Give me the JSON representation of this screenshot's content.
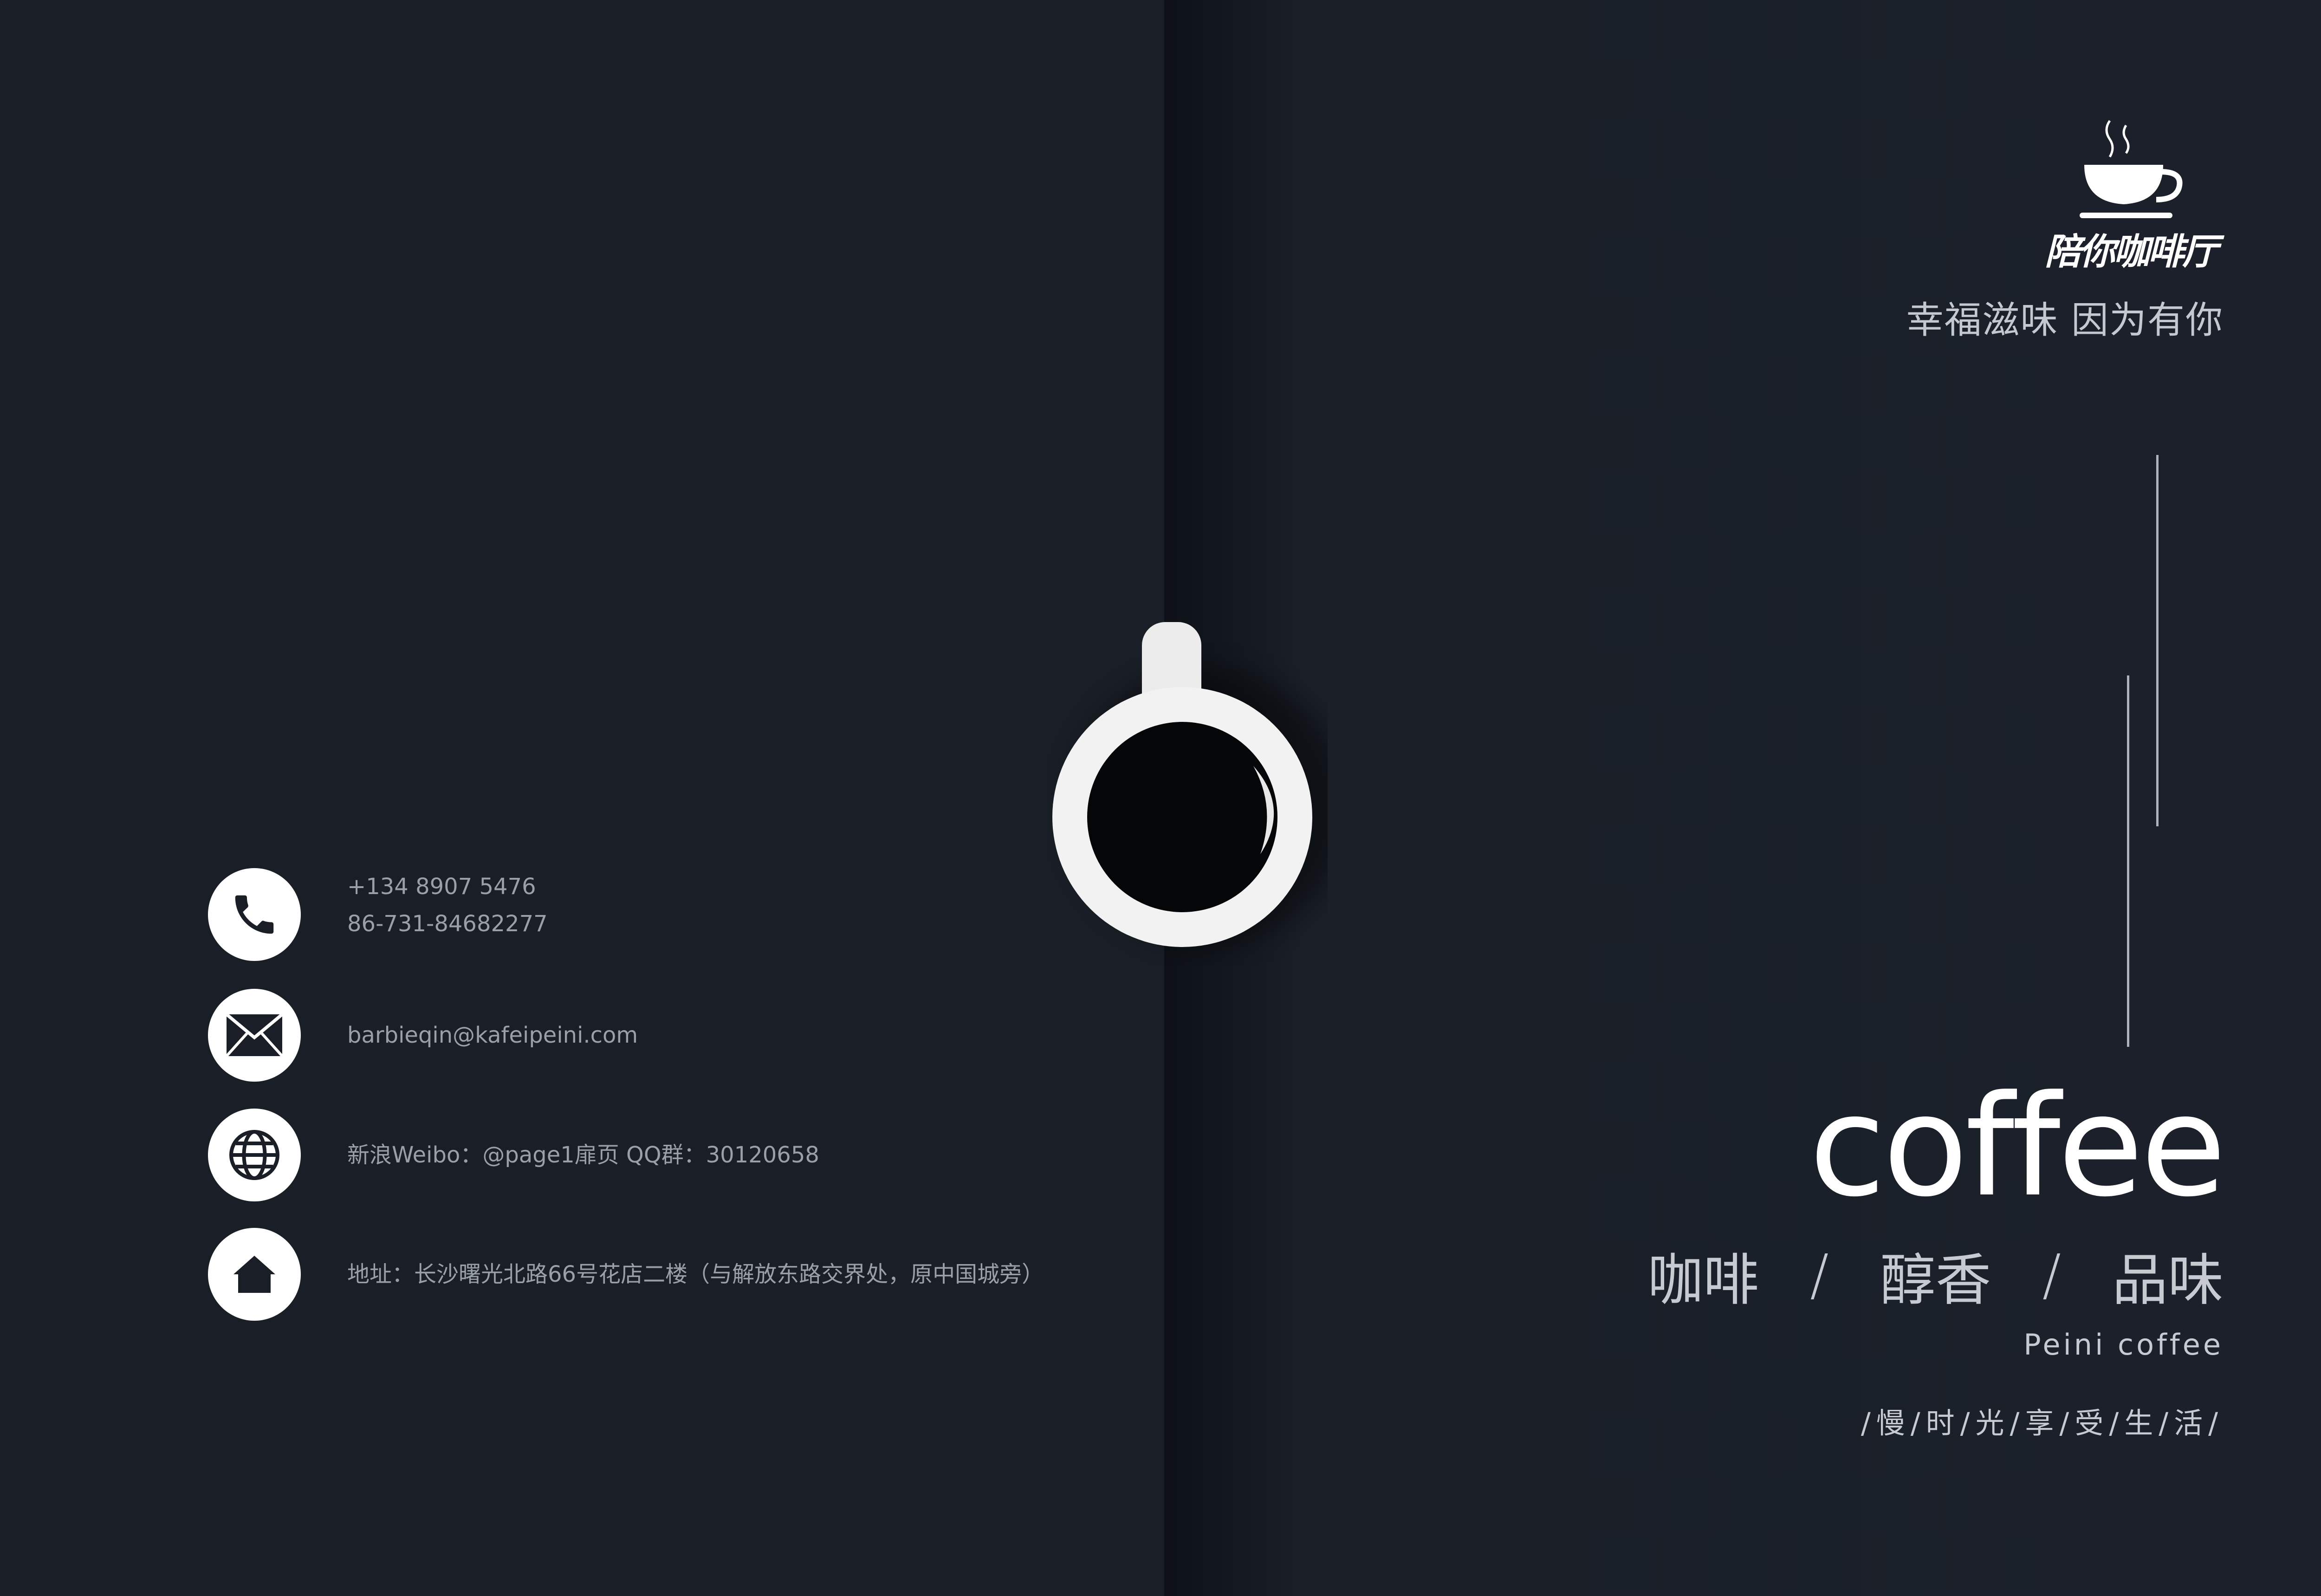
{
  "contacts": {
    "phone_line1": "+134 8907 5476",
    "phone_line2": "86-731-84682277",
    "email": "barbieqin@kafeipeini.com",
    "social": "新浪Weibo：@page1扉页   QQ群：30120658",
    "address": "地址：长沙曙光北路66号花店二楼（与解放东路交界处，原中国城旁）"
  },
  "logo": {
    "name": "陪你咖啡厅"
  },
  "slogan": "幸福滋味 因为有你",
  "title": "coffee",
  "keywords": [
    "咖啡",
    "醇香",
    "品味"
  ],
  "keyword_separator": "/",
  "brand": "Peini coffee",
  "tagline": "/慢/时/光/享/受/生/活/",
  "colors": {
    "background": "#1a1f28",
    "text": "#c7cbd1",
    "accent": "#ffffff"
  },
  "icons": [
    "phone-icon",
    "mail-icon",
    "globe-icon",
    "home-icon",
    "coffee-cup-icon",
    "coffee-logo-icon"
  ]
}
